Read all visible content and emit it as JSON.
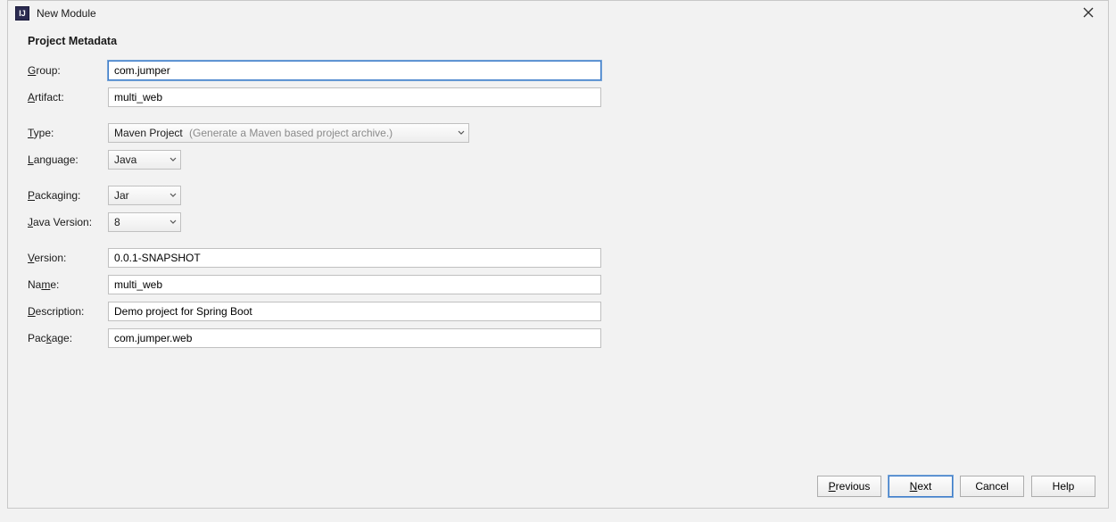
{
  "window": {
    "title": "New Module",
    "app_icon_text": "IJ"
  },
  "header": {
    "section_title": "Project Metadata"
  },
  "labels": {
    "group_pre": "",
    "group_mn": "G",
    "group_post": "roup:",
    "artifact_pre": "",
    "artifact_mn": "A",
    "artifact_post": "rtifact:",
    "type_pre": "",
    "type_mn": "T",
    "type_post": "ype:",
    "language_pre": "",
    "language_mn": "L",
    "language_post": "anguage:",
    "packaging_pre": "",
    "packaging_mn": "P",
    "packaging_post": "ackaging:",
    "javaver_pre": "",
    "javaver_mn": "J",
    "javaver_post": "ava Version:",
    "version_pre": "",
    "version_mn": "V",
    "version_post": "ersion:",
    "name_pre": "Na",
    "name_mn": "m",
    "name_post": "e:",
    "description_pre": "",
    "description_mn": "D",
    "description_post": "escription:",
    "package_pre": "Pac",
    "package_mn": "k",
    "package_post": "age:"
  },
  "fields": {
    "group": "com.jumper",
    "artifact": "multi_web",
    "type_value": "Maven Project",
    "type_hint": "(Generate a Maven based project archive.)",
    "language": "Java",
    "packaging": "Jar",
    "java_version": "8",
    "version": "0.0.1-SNAPSHOT",
    "name": "multi_web",
    "description": "Demo project for Spring Boot",
    "package": "com.jumper.web"
  },
  "buttons": {
    "previous_mn": "P",
    "previous_post": "revious",
    "next_pre": "",
    "next_mn": "N",
    "next_post": "ext",
    "cancel": "Cancel",
    "help": "Help"
  }
}
